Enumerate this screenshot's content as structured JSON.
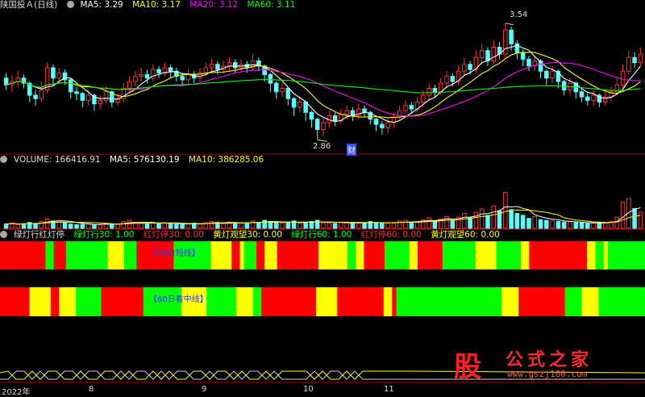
{
  "colors": {
    "up": "#ff3232",
    "down": "#54ffff",
    "ma5": "#ffffff",
    "ma10": "#ffff00",
    "ma20": "#ff00ff",
    "ma60": "#00ff00",
    "red": "#ff0000",
    "yellow": "#ffff00",
    "green": "#00ff00",
    "axis": "#b00000",
    "grid": "#7a0000"
  },
  "price_header": {
    "title": "陕国投Ａ(日线)",
    "ma5": "MA5: 3.29",
    "ma10": "MA10: 3.17",
    "ma20": "MA20: 3.12",
    "ma60": "MA60: 3.11"
  },
  "volume_header": {
    "label": "VOLUME: 166416.91",
    "ma5": "MA5: 576130.19",
    "ma10": "MA10: 386285.06"
  },
  "indicator_header": {
    "name": "绿灯行红灯停",
    "g30": "绿灯行30: 1.00",
    "r30": "红灯停30: 0.00",
    "y30": "黄灯观望30: 0.00",
    "g60": "绿灯行60: 1.00",
    "r60": "红灯停60: 0.00",
    "y60": "黄灯观望60: 0.00"
  },
  "band_labels": {
    "short": "【30日短线】",
    "long": "【60日看中线】"
  },
  "annotations": {
    "high": "3.54",
    "low": "2.86",
    "marker": "财"
  },
  "x_axis": {
    "labels": [
      "2022年",
      "8",
      "9",
      "10",
      "11"
    ]
  },
  "logo": {
    "gu": "股",
    "cn": "公式之家",
    "url": "www.gszj100.com"
  },
  "chart_data": [
    {
      "type": "candlestick",
      "title": "陕国投Ａ(日线)",
      "y_range": [
        2.8,
        3.6
      ],
      "candles": [
        [
          3.22,
          3.18,
          3.25,
          3.15
        ],
        [
          3.18,
          3.2,
          3.24,
          3.14
        ],
        [
          3.2,
          3.22,
          3.26,
          3.17
        ],
        [
          3.22,
          3.19,
          3.24,
          3.16
        ],
        [
          3.19,
          3.12,
          3.2,
          3.08
        ],
        [
          3.12,
          3.1,
          3.15,
          3.06
        ],
        [
          3.1,
          3.15,
          3.2,
          3.08
        ],
        [
          3.15,
          3.28,
          3.31,
          3.13
        ],
        [
          3.28,
          3.22,
          3.3,
          3.18
        ],
        [
          3.22,
          3.25,
          3.28,
          3.19
        ],
        [
          3.25,
          3.21,
          3.27,
          3.18
        ],
        [
          3.21,
          3.14,
          3.22,
          3.1
        ],
        [
          3.14,
          3.13,
          3.17,
          3.09
        ],
        [
          3.13,
          3.09,
          3.14,
          3.05
        ],
        [
          3.09,
          3.12,
          3.15,
          3.06
        ],
        [
          3.12,
          3.07,
          3.13,
          3.03
        ],
        [
          3.07,
          3.09,
          3.12,
          3.04
        ],
        [
          3.09,
          3.14,
          3.17,
          3.07
        ],
        [
          3.14,
          3.08,
          3.15,
          3.05
        ],
        [
          3.08,
          3.1,
          3.13,
          3.06
        ],
        [
          3.1,
          3.16,
          3.19,
          3.08
        ],
        [
          3.16,
          3.2,
          3.23,
          3.13
        ],
        [
          3.2,
          3.23,
          3.26,
          3.17
        ],
        [
          3.23,
          3.24,
          3.28,
          3.2
        ],
        [
          3.24,
          3.22,
          3.27,
          3.19
        ],
        [
          3.22,
          3.27,
          3.3,
          3.2
        ],
        [
          3.27,
          3.25,
          3.29,
          3.22
        ],
        [
          3.25,
          3.28,
          3.31,
          3.23
        ],
        [
          3.28,
          3.26,
          3.3,
          3.22
        ],
        [
          3.26,
          3.23,
          3.28,
          3.2
        ],
        [
          3.23,
          3.21,
          3.25,
          3.17
        ],
        [
          3.21,
          3.24,
          3.27,
          3.18
        ],
        [
          3.24,
          3.22,
          3.26,
          3.19
        ],
        [
          3.22,
          3.25,
          3.28,
          3.2
        ],
        [
          3.25,
          3.28,
          3.31,
          3.23
        ],
        [
          3.28,
          3.3,
          3.33,
          3.25
        ],
        [
          3.3,
          3.27,
          3.32,
          3.24
        ],
        [
          3.27,
          3.29,
          3.32,
          3.25
        ],
        [
          3.29,
          3.31,
          3.34,
          3.26
        ],
        [
          3.31,
          3.28,
          3.33,
          3.25
        ],
        [
          3.28,
          3.3,
          3.33,
          3.26
        ],
        [
          3.3,
          3.28,
          3.32,
          3.25
        ],
        [
          3.28,
          3.32,
          3.36,
          3.26
        ],
        [
          3.32,
          3.29,
          3.34,
          3.26
        ],
        [
          3.29,
          3.24,
          3.3,
          3.2
        ],
        [
          3.24,
          3.19,
          3.25,
          3.14
        ],
        [
          3.19,
          3.14,
          3.2,
          3.1
        ],
        [
          3.14,
          3.16,
          3.19,
          3.11
        ],
        [
          3.16,
          3.1,
          3.17,
          3.06
        ],
        [
          3.1,
          3.05,
          3.11,
          3.0
        ],
        [
          3.05,
          3.08,
          3.11,
          3.02
        ],
        [
          3.08,
          3.02,
          3.09,
          2.97
        ],
        [
          3.02,
          2.98,
          3.03,
          2.93
        ],
        [
          2.98,
          2.92,
          2.99,
          2.86
        ],
        [
          2.92,
          2.96,
          2.99,
          2.88
        ],
        [
          2.96,
          3.0,
          3.03,
          2.93
        ],
        [
          3.0,
          2.97,
          3.02,
          2.94
        ],
        [
          2.97,
          3.01,
          3.04,
          2.95
        ],
        [
          3.01,
          3.03,
          3.06,
          2.98
        ],
        [
          3.03,
          3.0,
          3.05,
          2.97
        ],
        [
          3.0,
          3.04,
          3.07,
          2.98
        ],
        [
          3.04,
          3.02,
          3.06,
          2.99
        ],
        [
          3.02,
          2.98,
          3.03,
          2.95
        ],
        [
          2.98,
          2.95,
          2.99,
          2.91
        ],
        [
          2.95,
          2.93,
          2.97,
          2.89
        ],
        [
          2.93,
          2.96,
          2.99,
          2.9
        ],
        [
          2.96,
          2.99,
          3.02,
          2.93
        ],
        [
          2.99,
          3.03,
          3.06,
          2.97
        ],
        [
          3.03,
          3.06,
          3.09,
          3.01
        ],
        [
          3.06,
          3.04,
          3.08,
          3.01
        ],
        [
          3.04,
          3.08,
          3.11,
          3.02
        ],
        [
          3.08,
          3.12,
          3.15,
          3.05
        ],
        [
          3.12,
          3.16,
          3.19,
          3.09
        ],
        [
          3.16,
          3.14,
          3.18,
          3.11
        ],
        [
          3.14,
          3.19,
          3.22,
          3.12
        ],
        [
          3.19,
          3.23,
          3.26,
          3.16
        ],
        [
          3.23,
          3.2,
          3.25,
          3.17
        ],
        [
          3.2,
          3.26,
          3.29,
          3.18
        ],
        [
          3.26,
          3.3,
          3.34,
          3.23
        ],
        [
          3.3,
          3.27,
          3.32,
          3.24
        ],
        [
          3.27,
          3.34,
          3.38,
          3.25
        ],
        [
          3.34,
          3.38,
          3.42,
          3.3
        ],
        [
          3.38,
          3.32,
          3.4,
          3.29
        ],
        [
          3.32,
          3.4,
          3.44,
          3.3
        ],
        [
          3.4,
          3.36,
          3.43,
          3.33
        ],
        [
          3.36,
          3.5,
          3.54,
          3.34
        ],
        [
          3.5,
          3.42,
          3.52,
          3.38
        ],
        [
          3.42,
          3.37,
          3.44,
          3.33
        ],
        [
          3.37,
          3.33,
          3.39,
          3.29
        ],
        [
          3.33,
          3.29,
          3.35,
          3.26
        ],
        [
          3.29,
          3.32,
          3.35,
          3.26
        ],
        [
          3.32,
          3.26,
          3.33,
          3.22
        ],
        [
          3.26,
          3.22,
          3.27,
          3.18
        ],
        [
          3.22,
          3.26,
          3.29,
          3.19
        ],
        [
          3.26,
          3.2,
          3.27,
          3.16
        ],
        [
          3.2,
          3.15,
          3.21,
          3.12
        ],
        [
          3.15,
          3.19,
          3.22,
          3.12
        ],
        [
          3.19,
          3.14,
          3.2,
          3.1
        ],
        [
          3.14,
          3.11,
          3.15,
          3.08
        ],
        [
          3.11,
          3.09,
          3.13,
          3.06
        ],
        [
          3.09,
          3.12,
          3.15,
          3.06
        ],
        [
          3.12,
          3.08,
          3.13,
          3.05
        ],
        [
          3.08,
          3.11,
          3.14,
          3.06
        ],
        [
          3.11,
          3.14,
          3.17,
          3.08
        ],
        [
          3.14,
          3.18,
          3.22,
          3.12
        ],
        [
          3.18,
          3.26,
          3.3,
          3.16
        ],
        [
          3.26,
          3.34,
          3.38,
          3.24
        ],
        [
          3.34,
          3.31,
          3.37,
          3.28
        ],
        [
          3.31,
          3.36,
          3.4,
          3.29
        ]
      ],
      "series": [
        {
          "name": "MA5"
        },
        {
          "name": "MA10"
        },
        {
          "name": "MA20"
        },
        {
          "name": "MA60"
        }
      ],
      "annotations": [
        {
          "text": "3.54",
          "type": "high"
        },
        {
          "text": "2.86",
          "type": "low"
        }
      ]
    },
    {
      "type": "bar",
      "title": "VOLUME",
      "y_range": [
        0,
        1000
      ],
      "values": [
        70,
        85,
        60,
        75,
        95,
        80,
        110,
        150,
        120,
        130,
        90,
        70,
        60,
        65,
        75,
        55,
        60,
        80,
        70,
        65,
        110,
        130,
        90,
        85,
        70,
        95,
        80,
        90,
        70,
        65,
        60,
        75,
        85,
        70,
        90,
        110,
        95,
        80,
        100,
        90,
        85,
        80,
        120,
        95,
        130,
        110,
        90,
        85,
        100,
        120,
        80,
        95,
        110,
        130,
        90,
        85,
        80,
        95,
        100,
        90,
        85,
        80,
        110,
        95,
        90,
        80,
        85,
        120,
        130,
        95,
        100,
        140,
        170,
        120,
        150,
        190,
        130,
        180,
        240,
        170,
        260,
        310,
        210,
        360,
        280,
        580,
        300,
        240,
        210,
        160,
        190,
        140,
        130,
        120,
        110,
        100,
        105,
        90,
        85,
        80,
        85,
        95,
        90,
        110,
        180,
        420,
        480,
        320,
        260
      ],
      "series": [
        {
          "name": "MA5"
        },
        {
          "name": "MA10"
        }
      ]
    },
    {
      "type": "heatmap",
      "title": "绿灯行红灯停",
      "rows": [
        {
          "name": "【30日短线】",
          "segments": [
            [
              "R",
              11
            ],
            [
              "G",
              2
            ],
            [
              "R",
              3
            ],
            [
              "G",
              10
            ],
            [
              "Y",
              4
            ],
            [
              "G",
              3
            ],
            [
              "R",
              9
            ],
            [
              "G",
              9
            ],
            [
              "Y",
              5
            ],
            [
              "R",
              2
            ],
            [
              "Y",
              1
            ],
            [
              "G",
              3
            ],
            [
              "R",
              2
            ],
            [
              "Y",
              3
            ],
            [
              "R",
              10
            ],
            [
              "Y",
              7
            ],
            [
              "G",
              2
            ],
            [
              "Y",
              2
            ],
            [
              "R",
              5
            ],
            [
              "G",
              6
            ],
            [
              "Y",
              2
            ],
            [
              "R",
              6
            ],
            [
              "G",
              8
            ],
            [
              "Y",
              5
            ],
            [
              "G",
              6
            ],
            [
              "Y",
              2
            ],
            [
              "R",
              14
            ],
            [
              "Y",
              2
            ],
            [
              "G",
              2
            ],
            [
              "Y",
              1
            ],
            [
              "G",
              9
            ]
          ]
        },
        {
          "name": "【60日看中线】",
          "segments": [
            [
              "R",
              7
            ],
            [
              "Y",
              5
            ],
            [
              "R",
              2
            ],
            [
              "Y",
              4
            ],
            [
              "G",
              6
            ],
            [
              "R",
              10
            ],
            [
              "G",
              9
            ],
            [
              "Y",
              6
            ],
            [
              "G",
              7
            ],
            [
              "Y",
              4
            ],
            [
              "G",
              2
            ],
            [
              "R",
              13
            ],
            [
              "Y",
              5
            ],
            [
              "R",
              11
            ],
            [
              "Y",
              2
            ],
            [
              "R",
              1
            ],
            [
              "G",
              25
            ],
            [
              "Y",
              4
            ],
            [
              "R",
              11
            ],
            [
              "G",
              4
            ],
            [
              "Y",
              4
            ],
            [
              "G",
              11
            ]
          ]
        }
      ]
    }
  ]
}
